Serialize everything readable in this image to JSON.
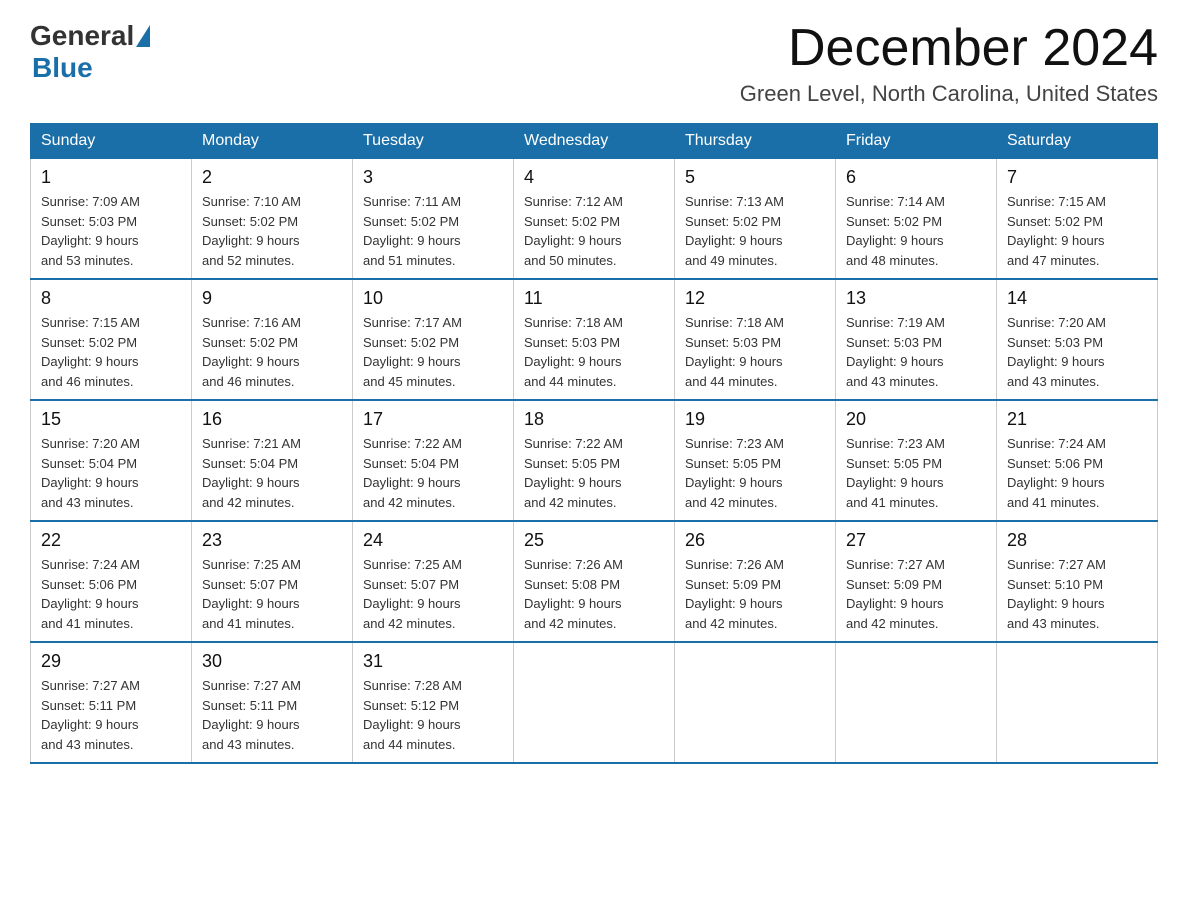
{
  "header": {
    "logo_general": "General",
    "logo_blue": "Blue",
    "month_title": "December 2024",
    "location": "Green Level, North Carolina, United States"
  },
  "days_of_week": [
    "Sunday",
    "Monday",
    "Tuesday",
    "Wednesday",
    "Thursday",
    "Friday",
    "Saturday"
  ],
  "weeks": [
    [
      {
        "num": "1",
        "sunrise": "7:09 AM",
        "sunset": "5:03 PM",
        "daylight": "9 hours and 53 minutes."
      },
      {
        "num": "2",
        "sunrise": "7:10 AM",
        "sunset": "5:02 PM",
        "daylight": "9 hours and 52 minutes."
      },
      {
        "num": "3",
        "sunrise": "7:11 AM",
        "sunset": "5:02 PM",
        "daylight": "9 hours and 51 minutes."
      },
      {
        "num": "4",
        "sunrise": "7:12 AM",
        "sunset": "5:02 PM",
        "daylight": "9 hours and 50 minutes."
      },
      {
        "num": "5",
        "sunrise": "7:13 AM",
        "sunset": "5:02 PM",
        "daylight": "9 hours and 49 minutes."
      },
      {
        "num": "6",
        "sunrise": "7:14 AM",
        "sunset": "5:02 PM",
        "daylight": "9 hours and 48 minutes."
      },
      {
        "num": "7",
        "sunrise": "7:15 AM",
        "sunset": "5:02 PM",
        "daylight": "9 hours and 47 minutes."
      }
    ],
    [
      {
        "num": "8",
        "sunrise": "7:15 AM",
        "sunset": "5:02 PM",
        "daylight": "9 hours and 46 minutes."
      },
      {
        "num": "9",
        "sunrise": "7:16 AM",
        "sunset": "5:02 PM",
        "daylight": "9 hours and 46 minutes."
      },
      {
        "num": "10",
        "sunrise": "7:17 AM",
        "sunset": "5:02 PM",
        "daylight": "9 hours and 45 minutes."
      },
      {
        "num": "11",
        "sunrise": "7:18 AM",
        "sunset": "5:03 PM",
        "daylight": "9 hours and 44 minutes."
      },
      {
        "num": "12",
        "sunrise": "7:18 AM",
        "sunset": "5:03 PM",
        "daylight": "9 hours and 44 minutes."
      },
      {
        "num": "13",
        "sunrise": "7:19 AM",
        "sunset": "5:03 PM",
        "daylight": "9 hours and 43 minutes."
      },
      {
        "num": "14",
        "sunrise": "7:20 AM",
        "sunset": "5:03 PM",
        "daylight": "9 hours and 43 minutes."
      }
    ],
    [
      {
        "num": "15",
        "sunrise": "7:20 AM",
        "sunset": "5:04 PM",
        "daylight": "9 hours and 43 minutes."
      },
      {
        "num": "16",
        "sunrise": "7:21 AM",
        "sunset": "5:04 PM",
        "daylight": "9 hours and 42 minutes."
      },
      {
        "num": "17",
        "sunrise": "7:22 AM",
        "sunset": "5:04 PM",
        "daylight": "9 hours and 42 minutes."
      },
      {
        "num": "18",
        "sunrise": "7:22 AM",
        "sunset": "5:05 PM",
        "daylight": "9 hours and 42 minutes."
      },
      {
        "num": "19",
        "sunrise": "7:23 AM",
        "sunset": "5:05 PM",
        "daylight": "9 hours and 42 minutes."
      },
      {
        "num": "20",
        "sunrise": "7:23 AM",
        "sunset": "5:05 PM",
        "daylight": "9 hours and 41 minutes."
      },
      {
        "num": "21",
        "sunrise": "7:24 AM",
        "sunset": "5:06 PM",
        "daylight": "9 hours and 41 minutes."
      }
    ],
    [
      {
        "num": "22",
        "sunrise": "7:24 AM",
        "sunset": "5:06 PM",
        "daylight": "9 hours and 41 minutes."
      },
      {
        "num": "23",
        "sunrise": "7:25 AM",
        "sunset": "5:07 PM",
        "daylight": "9 hours and 41 minutes."
      },
      {
        "num": "24",
        "sunrise": "7:25 AM",
        "sunset": "5:07 PM",
        "daylight": "9 hours and 42 minutes."
      },
      {
        "num": "25",
        "sunrise": "7:26 AM",
        "sunset": "5:08 PM",
        "daylight": "9 hours and 42 minutes."
      },
      {
        "num": "26",
        "sunrise": "7:26 AM",
        "sunset": "5:09 PM",
        "daylight": "9 hours and 42 minutes."
      },
      {
        "num": "27",
        "sunrise": "7:27 AM",
        "sunset": "5:09 PM",
        "daylight": "9 hours and 42 minutes."
      },
      {
        "num": "28",
        "sunrise": "7:27 AM",
        "sunset": "5:10 PM",
        "daylight": "9 hours and 43 minutes."
      }
    ],
    [
      {
        "num": "29",
        "sunrise": "7:27 AM",
        "sunset": "5:11 PM",
        "daylight": "9 hours and 43 minutes."
      },
      {
        "num": "30",
        "sunrise": "7:27 AM",
        "sunset": "5:11 PM",
        "daylight": "9 hours and 43 minutes."
      },
      {
        "num": "31",
        "sunrise": "7:28 AM",
        "sunset": "5:12 PM",
        "daylight": "9 hours and 44 minutes."
      },
      null,
      null,
      null,
      null
    ]
  ]
}
